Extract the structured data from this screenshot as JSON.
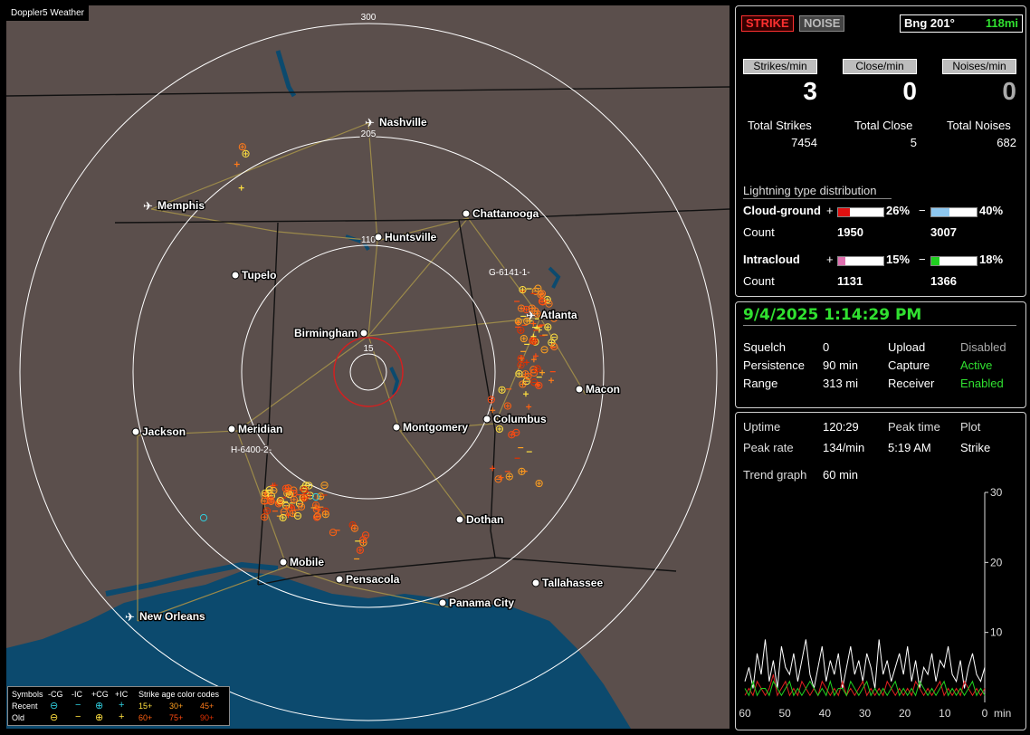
{
  "app": {
    "title": "Doppler5 Weather"
  },
  "map": {
    "range_rings": [
      "15",
      "110",
      "205",
      "300"
    ],
    "cities": [
      {
        "name": "Nashville",
        "airport": true
      },
      {
        "name": "Memphis",
        "airport": true
      },
      {
        "name": "Chattanooga",
        "airport": false
      },
      {
        "name": "Huntsville",
        "airport": false
      },
      {
        "name": "Tupelo",
        "airport": false
      },
      {
        "name": "Atlanta",
        "airport": true
      },
      {
        "name": "Birmingham",
        "airport": false
      },
      {
        "name": "Macon",
        "airport": false
      },
      {
        "name": "Jackson",
        "airport": false
      },
      {
        "name": "Meridian",
        "airport": false
      },
      {
        "name": "Montgomery",
        "airport": false
      },
      {
        "name": "Columbus",
        "airport": false
      },
      {
        "name": "Dothan",
        "airport": false
      },
      {
        "name": "Mobile",
        "airport": false
      },
      {
        "name": "Pensacola",
        "airport": false
      },
      {
        "name": "Tallahassee",
        "airport": false
      },
      {
        "name": "Panama City",
        "airport": false
      },
      {
        "name": "New Orleans",
        "airport": true
      }
    ],
    "cell_labels": [
      "G-6141-1-",
      "H-6400-2-"
    ],
    "colors": {
      "land": "#5b4f4c",
      "water": "#0c4a6e",
      "roads": "#9c8a4a",
      "rings": "#ffffff",
      "inner_ring": "#d42020"
    }
  },
  "legend": {
    "symbols_label": "Symbols",
    "cols": [
      "-CG",
      "-IC",
      "+CG",
      "+IC"
    ],
    "age_label": "Strike age color codes",
    "recent_label": "Recent",
    "old_label": "Old",
    "recent_ages": [
      "15+",
      "30+",
      "45+"
    ],
    "old_ages": [
      "60+",
      "75+",
      "90+"
    ],
    "age_colors": [
      "#ffe040",
      "#ffa020",
      "#ff7a1a",
      "#ff6010",
      "#ff4a10",
      "#e03000"
    ]
  },
  "top": {
    "strike_btn": "STRIKE",
    "noise_btn": "NOISE",
    "bearing": "Bng 201°",
    "distance": "118mi"
  },
  "rates": [
    {
      "label": "Strikes/min",
      "value": "3",
      "total_label": "Total Strikes",
      "total": "7454"
    },
    {
      "label": "Close/min",
      "value": "0",
      "total_label": "Total Close",
      "total": "5"
    },
    {
      "label": "Noises/min",
      "value": "0",
      "total_label": "Total Noises",
      "total": "682"
    }
  ],
  "distribution": {
    "title": "Lightning type distribution",
    "count_label": "Count",
    "rows": [
      {
        "name": "Cloud-ground",
        "pos_sign": "+",
        "pos_pct": "26%",
        "pos_frac": 0.26,
        "pos_color": "#e01010",
        "neg_sign": "−",
        "neg_pct": "40%",
        "neg_frac": 0.4,
        "neg_color": "#8ec8f0",
        "pos_count": "1950",
        "neg_count": "3007"
      },
      {
        "name": "Intracloud",
        "pos_sign": "+",
        "pos_pct": "15%",
        "pos_frac": 0.15,
        "pos_color": "#e070b0",
        "neg_sign": "−",
        "neg_pct": "18%",
        "neg_frac": 0.18,
        "neg_color": "#20d020",
        "pos_count": "1131",
        "neg_count": "1366"
      }
    ]
  },
  "status": {
    "datetime": "9/4/2025 1:14:29 PM",
    "squelch_label": "Squelch",
    "squelch": "0",
    "upload_label": "Upload",
    "upload": "Disabled",
    "persistence_label": "Persistence",
    "persistence": "90 min",
    "capture_label": "Capture",
    "capture": "Active",
    "range_label": "Range",
    "range": "313 mi",
    "receiver_label": "Receiver",
    "receiver": "Enabled",
    "green": "#30e030"
  },
  "stats": {
    "uptime_label": "Uptime",
    "uptime": "120:29",
    "peak_time_label": "Peak time",
    "peak_time": "5:19 AM",
    "plot_label": "Plot",
    "plot": "Strike",
    "peak_rate_label": "Peak rate",
    "peak_rate": "134/min",
    "trend_label": "Trend graph",
    "trend": "60 min"
  },
  "chart_data": {
    "type": "line",
    "title": "",
    "xlabel": "min",
    "x_ticks": [
      "60",
      "50",
      "40",
      "30",
      "20",
      "10",
      "0"
    ],
    "xlim": [
      60,
      0
    ],
    "y_ticks": [
      "30",
      "20",
      "10"
    ],
    "ylim": [
      0,
      30
    ],
    "series": [
      {
        "color": "#ffffff",
        "values": [
          3,
          5,
          2,
          7,
          4,
          9,
          3,
          6,
          2,
          8,
          5,
          4,
          7,
          3,
          6,
          9,
          4,
          2,
          5,
          8,
          3,
          6,
          4,
          7,
          2,
          5,
          8,
          4,
          6,
          3,
          7,
          5,
          2,
          9,
          4,
          6,
          3,
          5,
          7,
          4,
          8,
          3,
          6,
          2,
          5,
          4,
          7,
          3,
          6,
          5,
          8,
          4,
          3,
          6,
          2,
          5,
          7,
          4,
          3,
          5
        ]
      },
      {
        "color": "#e02020",
        "values": [
          1,
          2,
          1,
          3,
          2,
          1,
          2,
          4,
          1,
          2,
          3,
          1,
          2,
          1,
          3,
          2,
          1,
          2,
          1,
          3,
          2,
          1,
          2,
          1,
          3,
          1,
          2,
          1,
          2,
          3,
          1,
          2,
          1,
          2,
          1,
          3,
          2,
          1,
          2,
          1,
          2,
          1,
          3,
          2,
          1,
          2,
          1,
          2,
          3,
          1,
          2,
          1,
          2,
          1,
          3,
          2,
          1,
          2,
          1,
          2
        ]
      },
      {
        "color": "#20d020",
        "values": [
          2,
          1,
          3,
          1,
          2,
          2,
          1,
          3,
          2,
          1,
          2,
          3,
          1,
          2,
          1,
          2,
          3,
          2,
          1,
          2,
          1,
          3,
          1,
          2,
          2,
          1,
          3,
          2,
          1,
          2,
          3,
          1,
          2,
          1,
          2,
          1,
          2,
          3,
          1,
          2,
          1,
          2,
          1,
          3,
          2,
          1,
          2,
          1,
          2,
          3,
          1,
          2,
          1,
          2,
          1,
          2,
          3,
          1,
          2,
          1
        ]
      }
    ]
  }
}
